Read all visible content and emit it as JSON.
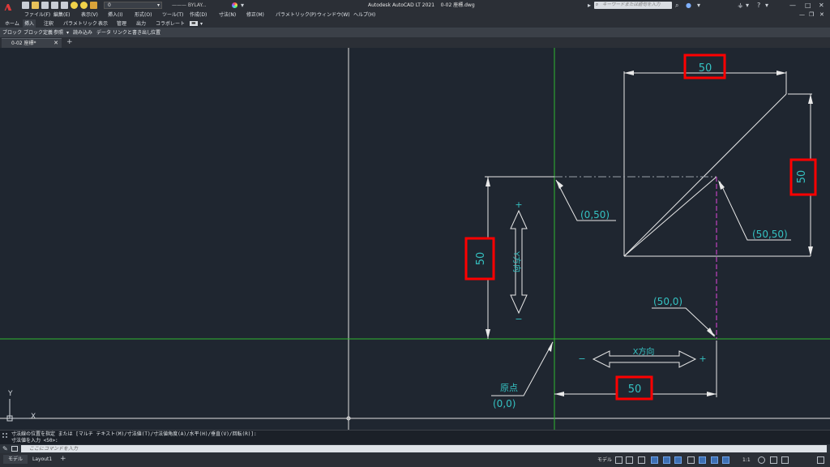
{
  "app": {
    "title": "Autodesk AutoCAD LT 2021    0-02 座標.dwg",
    "logo": "A"
  },
  "quick_access": {
    "layer_value": "0",
    "linetype_value": "——— BYLAY...",
    "search_placeholder": "キーワードまたは語句を入力"
  },
  "menu": [
    "ファイル(F)",
    "編集(E)",
    "表示(V)",
    "挿入(I)",
    "形式(O)",
    "ツール(T)",
    "作成(D)",
    "寸法(N)",
    "修正(M)",
    "パラメトリック(P)",
    "ウィンドウ(W)",
    "ヘルプ(H)"
  ],
  "ribbon": {
    "tabs": [
      "ホーム",
      "挿入",
      "注釈",
      "パラメトリック",
      "表示",
      "管理",
      "出力",
      "コラボレート"
    ],
    "active_tab": "挿入",
    "panels": [
      "ブロック",
      "ブロック定義",
      "参照",
      "読み込み",
      "データ",
      "リンクと書き出し",
      "位置"
    ]
  },
  "file_tab": {
    "name": "0-02 座標*"
  },
  "drawing": {
    "dims": {
      "top": "50",
      "right": "50",
      "left": "50",
      "bottom": "50"
    },
    "labels": {
      "p050": "(0,50)",
      "p5050": "(50,50)",
      "p500": "(50,0)",
      "origin_name": "原点",
      "origin": "(0,0)",
      "x_dir": "X方向",
      "y_dir": "Y方向",
      "plus": "+",
      "minus": "−",
      "ucs_x": "X",
      "ucs_y": "Y"
    },
    "colors": {
      "background": "#1f2630",
      "axis": "#2fb82f",
      "geometry": "#e8e8e8",
      "dimension": "#35c2c2",
      "highlight": "#ff0000",
      "centerline": "#c040c0"
    }
  },
  "command": {
    "history_1": "寸法線の位置を指定 または [マルチ テキスト(M)/寸法値(T)/寸法値角度(A)/水平(H)/垂直(V)/回転(R)]:",
    "history_2": "寸法値を入力 <50>:",
    "input_placeholder": "ここにコマンドを入力"
  },
  "status": {
    "layouts": [
      "モデル",
      "Layout1"
    ],
    "model_label": "モデル",
    "scale": "1:1"
  }
}
